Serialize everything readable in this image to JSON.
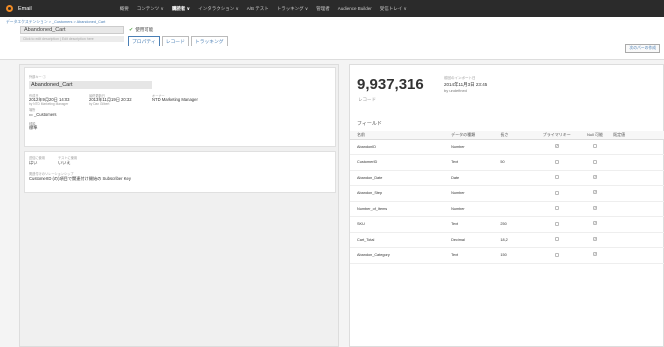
{
  "nav": {
    "app_name": "Email",
    "items": [
      {
        "label": "概要",
        "active": false
      },
      {
        "label": "コンテンツ ∨",
        "active": false
      },
      {
        "label": "購読者 ∨",
        "active": true
      },
      {
        "label": "インタラクション ∨",
        "active": false
      },
      {
        "label": "A/B テスト",
        "active": false
      },
      {
        "label": "トラッキング ∨",
        "active": false
      },
      {
        "label": "管理者",
        "active": false
      },
      {
        "label": "Audience Builder",
        "active": false
      },
      {
        "label": "受信トレイ ∨",
        "active": false
      }
    ]
  },
  "header": {
    "breadcrumb": "データエクステンション > _Customers > Abandoned_Cart",
    "name": "Abandoned_Cart",
    "description_placeholder": "Click to edit description | Edit description here",
    "status": "使用可能",
    "tabs": [
      {
        "label": "プロパティ",
        "active": true
      },
      {
        "label": "レコード",
        "active": false
      },
      {
        "label": "トラッキング",
        "active": false
      }
    ],
    "right_button": "次のパーの作成"
  },
  "properties": {
    "name_label": "外部キー ⓘ",
    "name_value": "Abandoned_Cart",
    "created_label": "作成日",
    "created_value": "2012年9月20日 14:03",
    "created_by": "by NTD Marketing Manager",
    "modified_label": "最終更新日",
    "modified_value": "2013年11月19日 20:32",
    "modified_by": "by Dan Gilbert",
    "owner_label": "オーナー",
    "owner_value": "NTD Marketing Manager",
    "location_label": "場所",
    "location_value": "_Customers",
    "type_label": "種類",
    "type_value": "標準"
  },
  "keys": {
    "send_label": "送信に使用",
    "send_value": "はい",
    "test_label": "テストに使用",
    "test_value": "いいえ",
    "relation_label": "関連付けのリレーションシップ",
    "relation_value": "CustomerID (の)項目で関連付け開始の Subscriber Key"
  },
  "summary": {
    "count": "9,937,316",
    "count_label": "レコード",
    "updated_label": "前回のインポート日",
    "updated_value": "2014年11月3日 23:45",
    "updated_by": "by undefined"
  },
  "fields": {
    "title": "フィールド",
    "headers": [
      "名前",
      "データの種類",
      "長さ",
      "プライマリキー",
      "Null 可能",
      "既定値"
    ],
    "rows": [
      {
        "name": "AbandonID",
        "type": "Number",
        "length": "",
        "pk": true,
        "nullable": false,
        "default": ""
      },
      {
        "name": "CustomerID",
        "type": "Text",
        "length": "50",
        "pk": false,
        "nullable": false,
        "default": ""
      },
      {
        "name": "Abandon_Date",
        "type": "Date",
        "length": "",
        "pk": false,
        "nullable": true,
        "default": ""
      },
      {
        "name": "Abandon_Step",
        "type": "Number",
        "length": "",
        "pk": false,
        "nullable": true,
        "default": ""
      },
      {
        "name": "Number_of_Items",
        "type": "Number",
        "length": "",
        "pk": false,
        "nullable": true,
        "default": ""
      },
      {
        "name": "SKU",
        "type": "Text",
        "length": "250",
        "pk": false,
        "nullable": true,
        "default": ""
      },
      {
        "name": "Cart_Total",
        "type": "Decimal",
        "length": "18,2",
        "pk": false,
        "nullable": true,
        "default": ""
      },
      {
        "name": "Abandon_Category",
        "type": "Text",
        "length": "150",
        "pk": false,
        "nullable": true,
        "default": ""
      }
    ]
  },
  "colors": {
    "nav_bg": "#2b2b2b",
    "logo": "#f08a24",
    "link": "#4a7fb5",
    "check": "#5ba84f"
  }
}
